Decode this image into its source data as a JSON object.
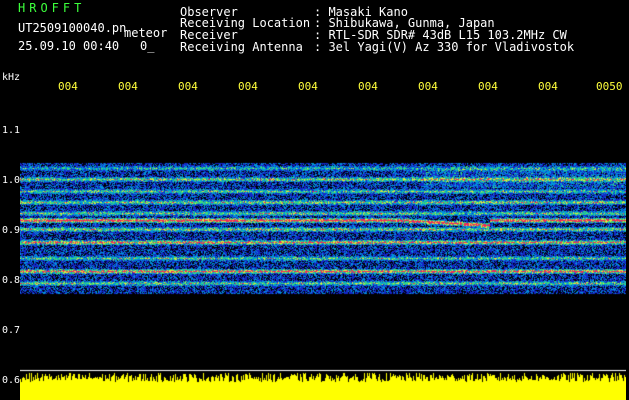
{
  "header": {
    "brand": "HROFFT",
    "filename": "UT2509100040.pn",
    "mode": "meteor",
    "datetime": "25.09.10 00:40",
    "counter": "0_",
    "fields": [
      {
        "label": "Observer",
        "value": ": Masaki Kano"
      },
      {
        "label": "Receiving Location",
        "value": ": Shibukawa, Gunma, Japan"
      },
      {
        "label": "Receiver",
        "value": ": RTL-SDR SDR# 43dB L15 103.2MHz CW"
      },
      {
        "label": "Receiving Antenna",
        "value": ": 3el Yagi(V) Az 330 for Vladivostok"
      }
    ]
  },
  "axis": {
    "unit": "kHz",
    "y_ticks": [
      "1.1",
      "1.0",
      "0.9",
      "0.8",
      "0.7",
      "0.6"
    ],
    "x_ticks": [
      "004",
      "004",
      "004",
      "004",
      "004",
      "004",
      "004",
      "004",
      "004",
      "0050"
    ]
  },
  "colors": {
    "text": "#ffffff",
    "brand": "#3cff3c",
    "x_ticks": "#ffff3c",
    "signal_bar": "#ffff00",
    "background": "#000000"
  }
}
